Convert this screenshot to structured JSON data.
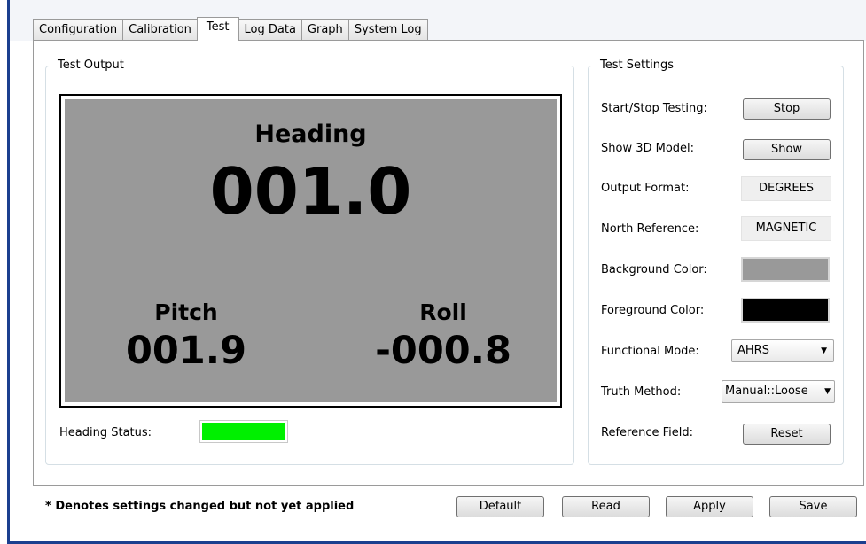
{
  "tabs": [
    {
      "label": "Configuration"
    },
    {
      "label": "Calibration"
    },
    {
      "label": "Test",
      "active": true
    },
    {
      "label": "Log Data"
    },
    {
      "label": "Graph"
    },
    {
      "label": "System Log"
    }
  ],
  "test_output": {
    "title": "Test Output",
    "heading_label": "Heading",
    "heading_value": "001.0",
    "pitch_label": "Pitch",
    "pitch_value": "001.9",
    "roll_label": "Roll",
    "roll_value": "-000.8",
    "display_background": "#999999",
    "display_foreground": "#000000",
    "heading_status_label": "Heading Status:",
    "heading_status_color": "#00f000"
  },
  "test_settings": {
    "title": "Test Settings",
    "start_stop_label": "Start/Stop Testing:",
    "start_stop_button": "Stop",
    "show_3d_label": "Show 3D Model:",
    "show_3d_button": "Show",
    "output_format_label": "Output Format:",
    "output_format_value": "DEGREES",
    "north_reference_label": "North Reference:",
    "north_reference_value": "MAGNETIC",
    "background_color_label": "Background Color:",
    "background_color": "#999999",
    "foreground_color_label": "Foreground Color:",
    "foreground_color": "#000000",
    "functional_mode_label": "Functional Mode:",
    "functional_mode_value": "AHRS",
    "truth_method_label": "Truth Method:",
    "truth_method_value": "Manual::Loose",
    "reference_field_label": "Reference Field:",
    "reference_field_button": "Reset"
  },
  "footer": {
    "note": "* Denotes settings changed but not yet applied",
    "default_button": "Default",
    "read_button": "Read",
    "apply_button": "Apply",
    "save_button": "Save"
  },
  "icons": {
    "dropdown_arrow": "chevron-down-icon"
  }
}
